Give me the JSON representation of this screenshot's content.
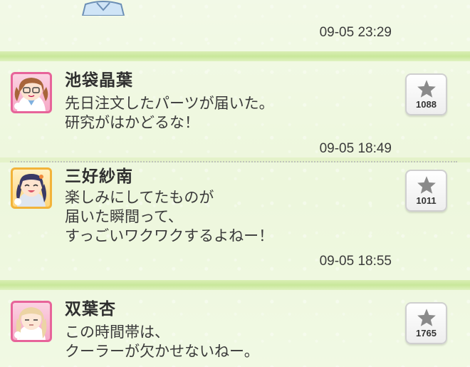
{
  "feed": {
    "top_partial": {
      "timestamp": "09-05 23:29"
    },
    "posts": [
      {
        "name": "池袋晶葉",
        "message_lines": [
          "先日注文したパーツが届いた。",
          "研究がはかどるな！"
        ],
        "timestamp": "09-05 18:49",
        "fav_count": "1088",
        "avatar_frame_color": "#e7649a"
      },
      {
        "name": "三好紗南",
        "message_lines": [
          "楽しみにしてたものが",
          "届いた瞬間って、",
          "すっごいワクワクするよねー！"
        ],
        "timestamp": "09-05 18:55",
        "fav_count": "1011",
        "avatar_frame_color": "#f2b33a"
      },
      {
        "name": "双葉杏",
        "message_lines": [
          "この時間帯は、",
          "クーラーが欠かせないねー。"
        ],
        "fav_count": "1765",
        "avatar_frame_color": "#e7649a"
      }
    ]
  },
  "colors": {
    "background": "#e6f3cf",
    "separator": "#c9e79a",
    "star": "#8a8a8a"
  }
}
